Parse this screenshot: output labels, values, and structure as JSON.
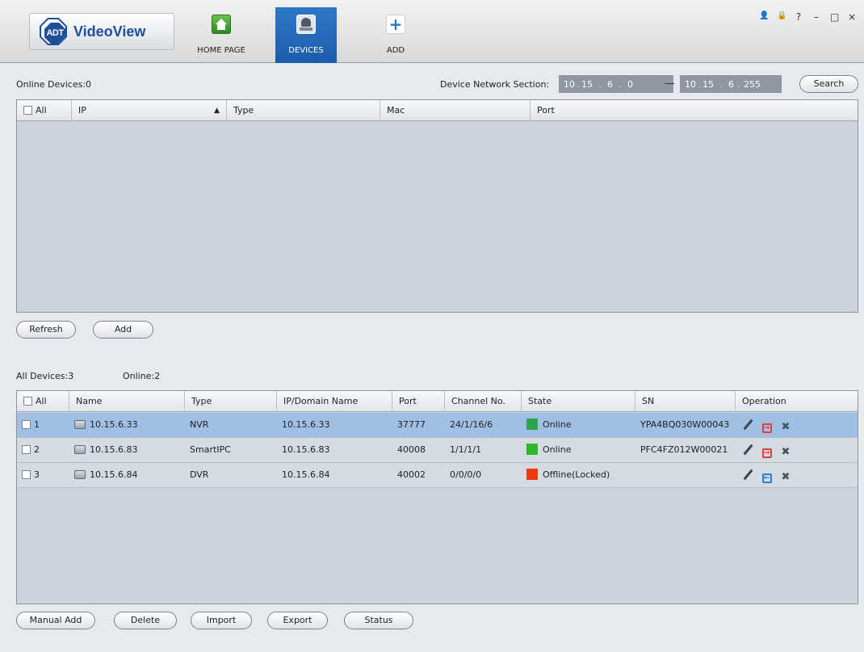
{
  "app": {
    "logo_badge": "ADT",
    "logo_text": "VideoView"
  },
  "nav": [
    {
      "label": "HOME PAGE",
      "icon": "home-icon"
    },
    {
      "label": "DEVICES",
      "icon": "devices-icon",
      "active": true
    },
    {
      "label": "ADD",
      "icon": "add-icon",
      "glyph": "+"
    }
  ],
  "window_controls": [
    {
      "name": "user-icon",
      "glyph": "👤"
    },
    {
      "name": "lock-icon",
      "glyph": "🔒"
    },
    {
      "name": "help-icon",
      "glyph": "?"
    },
    {
      "name": "minimize-icon",
      "glyph": "–"
    },
    {
      "name": "maximize-icon",
      "glyph": "□"
    },
    {
      "name": "close-icon",
      "glyph": "×"
    }
  ],
  "online": {
    "title": "Online Devices:0",
    "network_label": "Device Network Section:",
    "ip_start": [
      "10",
      "15",
      "6",
      "0"
    ],
    "ip_end": [
      "10",
      "15",
      "6",
      "255"
    ],
    "dash": "—",
    "search": "Search",
    "headers": {
      "all": "All",
      "ip": "IP",
      "type": "Type",
      "mac": "Mac",
      "port": "Port"
    },
    "sort_arrow": "▲",
    "refresh": "Refresh",
    "add": "Add"
  },
  "all_devices": {
    "title": "All Devices:3",
    "online": "Online:2",
    "headers": {
      "all": "All",
      "name": "Name",
      "type": "Type",
      "ip_domain": "IP/Domain Name",
      "port": "Port",
      "channel": "Channel No.",
      "state": "State",
      "sn": "SN",
      "operation": "Operation"
    },
    "rows": [
      {
        "num": "1",
        "name": "10.15.6.33",
        "type": "NVR",
        "ip": "10.15.6.33",
        "port": "37777",
        "channel": "24/1/16/6",
        "state": "Online",
        "state_color": "#2ea44f",
        "sn": "YPA4BQ030W00043",
        "logout_color": "#e03c3c"
      },
      {
        "num": "2",
        "name": "10.15.6.83",
        "type": "SmartIPC",
        "ip": "10.15.6.83",
        "port": "40008",
        "channel": "1/1/1/1",
        "state": "Online",
        "state_color": "#2db82d",
        "sn": "PFC4FZ012W00021",
        "logout_color": "#e03c3c"
      },
      {
        "num": "3",
        "name": "10.15.6.84",
        "type": "DVR",
        "ip": "10.15.6.84",
        "port": "40002",
        "channel": "0/0/0/0",
        "state": "Offline(Locked)",
        "state_color": "#ee3a10",
        "sn": "",
        "logout_color": "#2a7dd8"
      }
    ],
    "buttons": {
      "manual_add": "Manual Add",
      "delete": "Delete",
      "import": "Import",
      "export": "Export",
      "status": "Status"
    }
  }
}
